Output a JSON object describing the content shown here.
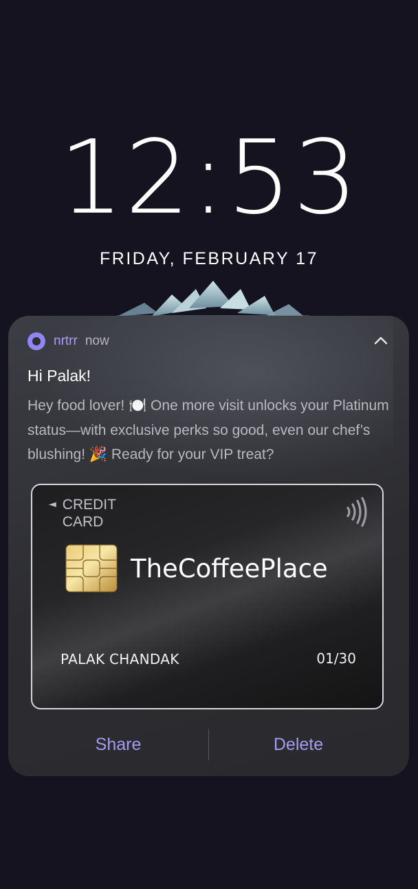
{
  "lockscreen": {
    "time": "12:53",
    "date": "FRIDAY, FEBRUARY 17"
  },
  "notification": {
    "app_name": "nrtrr",
    "time_ago": "now",
    "title": "Hi Palak!",
    "body": "Hey food lover! 🍽️ One more visit unlocks your Platinum status—with exclusive perks so good, even our chef’s blushing! 🎉 Ready for your VIP treat?",
    "card": {
      "type_label": "CREDIT CARD",
      "merchant": "TheCoffeePlace",
      "holder": "PALAK CHANDAK",
      "expiry": "01/30"
    },
    "actions": {
      "share": "Share",
      "delete": "Delete"
    }
  },
  "colors": {
    "background": "#14131f",
    "accent": "#a49bf3",
    "app_icon": "#8f86f2"
  },
  "icons": [
    "app-icon",
    "chevron-up-icon",
    "contactless-icon",
    "sim-chip-icon",
    "left-arrow-icon"
  ]
}
